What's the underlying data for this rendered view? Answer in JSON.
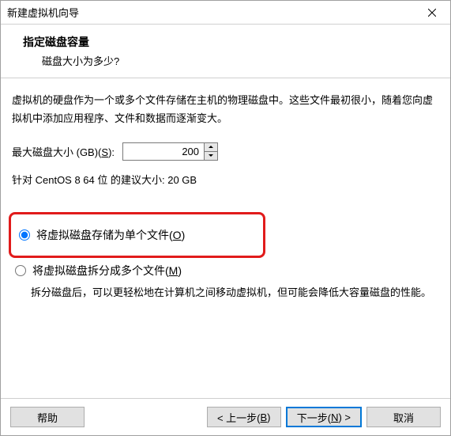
{
  "titlebar": {
    "title": "新建虚拟机向导"
  },
  "header": {
    "title": "指定磁盘容量",
    "subtitle": "磁盘大小为多少?"
  },
  "description": "虚拟机的硬盘作为一个或多个文件存储在主机的物理磁盘中。这些文件最初很小，随着您向虚拟机中添加应用程序、文件和数据而逐渐变大。",
  "size": {
    "label_prefix": "最大磁盘大小 (GB)(",
    "label_mnemonic": "S",
    "label_suffix": "):",
    "value": "200"
  },
  "recommend": "针对 CentOS 8 64 位 的建议大小: 20 GB",
  "options": {
    "single": {
      "prefix": "将虚拟磁盘存储为单个文件(",
      "mnemonic": "O",
      "suffix": ")",
      "checked": true
    },
    "split": {
      "prefix": "将虚拟磁盘拆分成多个文件(",
      "mnemonic": "M",
      "suffix": ")",
      "checked": false,
      "desc": "拆分磁盘后，可以更轻松地在计算机之间移动虚拟机，但可能会降低大容量磁盘的性能。"
    }
  },
  "buttons": {
    "help": "帮助",
    "back_prefix": "< 上一步(",
    "back_mnemonic": "B",
    "back_suffix": ")",
    "next_prefix": "下一步(",
    "next_mnemonic": "N",
    "next_suffix": ") >",
    "cancel": "取消"
  }
}
